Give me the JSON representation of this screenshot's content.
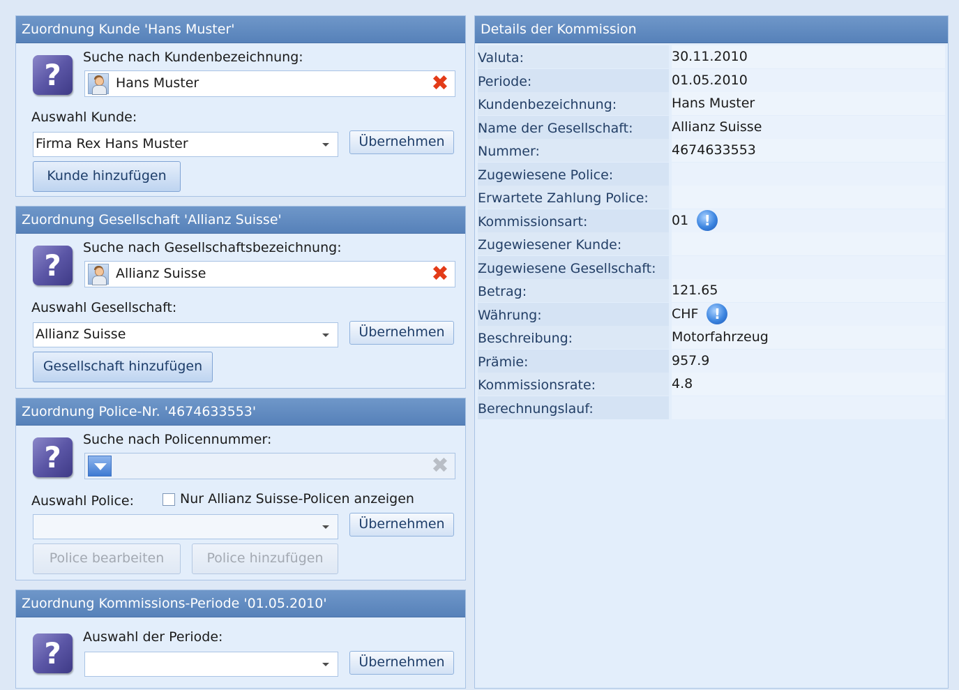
{
  "customer_panel": {
    "title": "Zuordnung Kunde 'Hans Muster'",
    "search_label": "Suche nach Kundenbezeichnung:",
    "search_value": "Hans Muster",
    "select_label": "Auswahl Kunde:",
    "select_value": "Firma Rex Hans Muster",
    "apply_label": "Übernehmen",
    "add_label": "Kunde hinzufügen"
  },
  "company_panel": {
    "title": "Zuordnung Gesellschaft 'Allianz Suisse'",
    "search_label": "Suche nach Gesellschaftsbezeichnung:",
    "search_value": "Allianz Suisse",
    "select_label": "Auswahl Gesellschaft:",
    "select_value": "Allianz Suisse",
    "apply_label": "Übernehmen",
    "add_label": "Gesellschaft hinzufügen"
  },
  "policy_panel": {
    "title": "Zuordnung Police-Nr. '4674633553'",
    "search_label": "Suche nach Policennummer:",
    "search_value": "",
    "select_label": "Auswahl Police:",
    "checkbox_label": "Nur Allianz Suisse-Policen anzeigen",
    "checkbox_checked": false,
    "select_value": "",
    "apply_label": "Übernehmen",
    "edit_label": "Police bearbeiten",
    "add_label": "Police hinzufügen"
  },
  "period_panel": {
    "title": "Zuordnung Kommissions-Periode '01.05.2010'",
    "select_label": "Auswahl der Periode:",
    "select_value": "",
    "apply_label": "Übernehmen"
  },
  "details": {
    "title": "Details der Kommission",
    "rows": [
      {
        "key": "Valuta:",
        "value": "30.11.2010"
      },
      {
        "key": "Periode:",
        "value": "01.05.2010"
      },
      {
        "key": "Kundenbezeichnung:",
        "value": "Hans Muster"
      },
      {
        "key": "Name der Gesellschaft:",
        "value": "Allianz Suisse"
      },
      {
        "key": "Nummer:",
        "value": "4674633553"
      },
      {
        "key": "Zugewiesene Police:",
        "value": ""
      },
      {
        "key": "Erwartete Zahlung Police:",
        "value": ""
      },
      {
        "key": "Kommissionsart:",
        "value": "01"
      },
      {
        "key": "Zugewiesener Kunde:",
        "value": ""
      },
      {
        "key": "Zugewiesene Gesellschaft:",
        "value": ""
      },
      {
        "key": "Betrag:",
        "value": "121.65"
      },
      {
        "key": "Währung:",
        "value": "CHF"
      },
      {
        "key": "Beschreibung:",
        "value": "Motorfahrzeug"
      },
      {
        "key": "Prämie:",
        "value": "957.9"
      },
      {
        "key": "Kommissionsrate:",
        "value": "4.8"
      },
      {
        "key": "Berechnungslauf:",
        "value": ""
      }
    ]
  },
  "icons": {
    "help": "help-icon",
    "person": "person-icon",
    "clear": "clear-icon",
    "info": "info-icon",
    "dropdown": "dropdown-icon"
  },
  "colors": {
    "header": "#5b85bc",
    "panel_bg": "#e3eefb",
    "clear": "#e33b18"
  }
}
